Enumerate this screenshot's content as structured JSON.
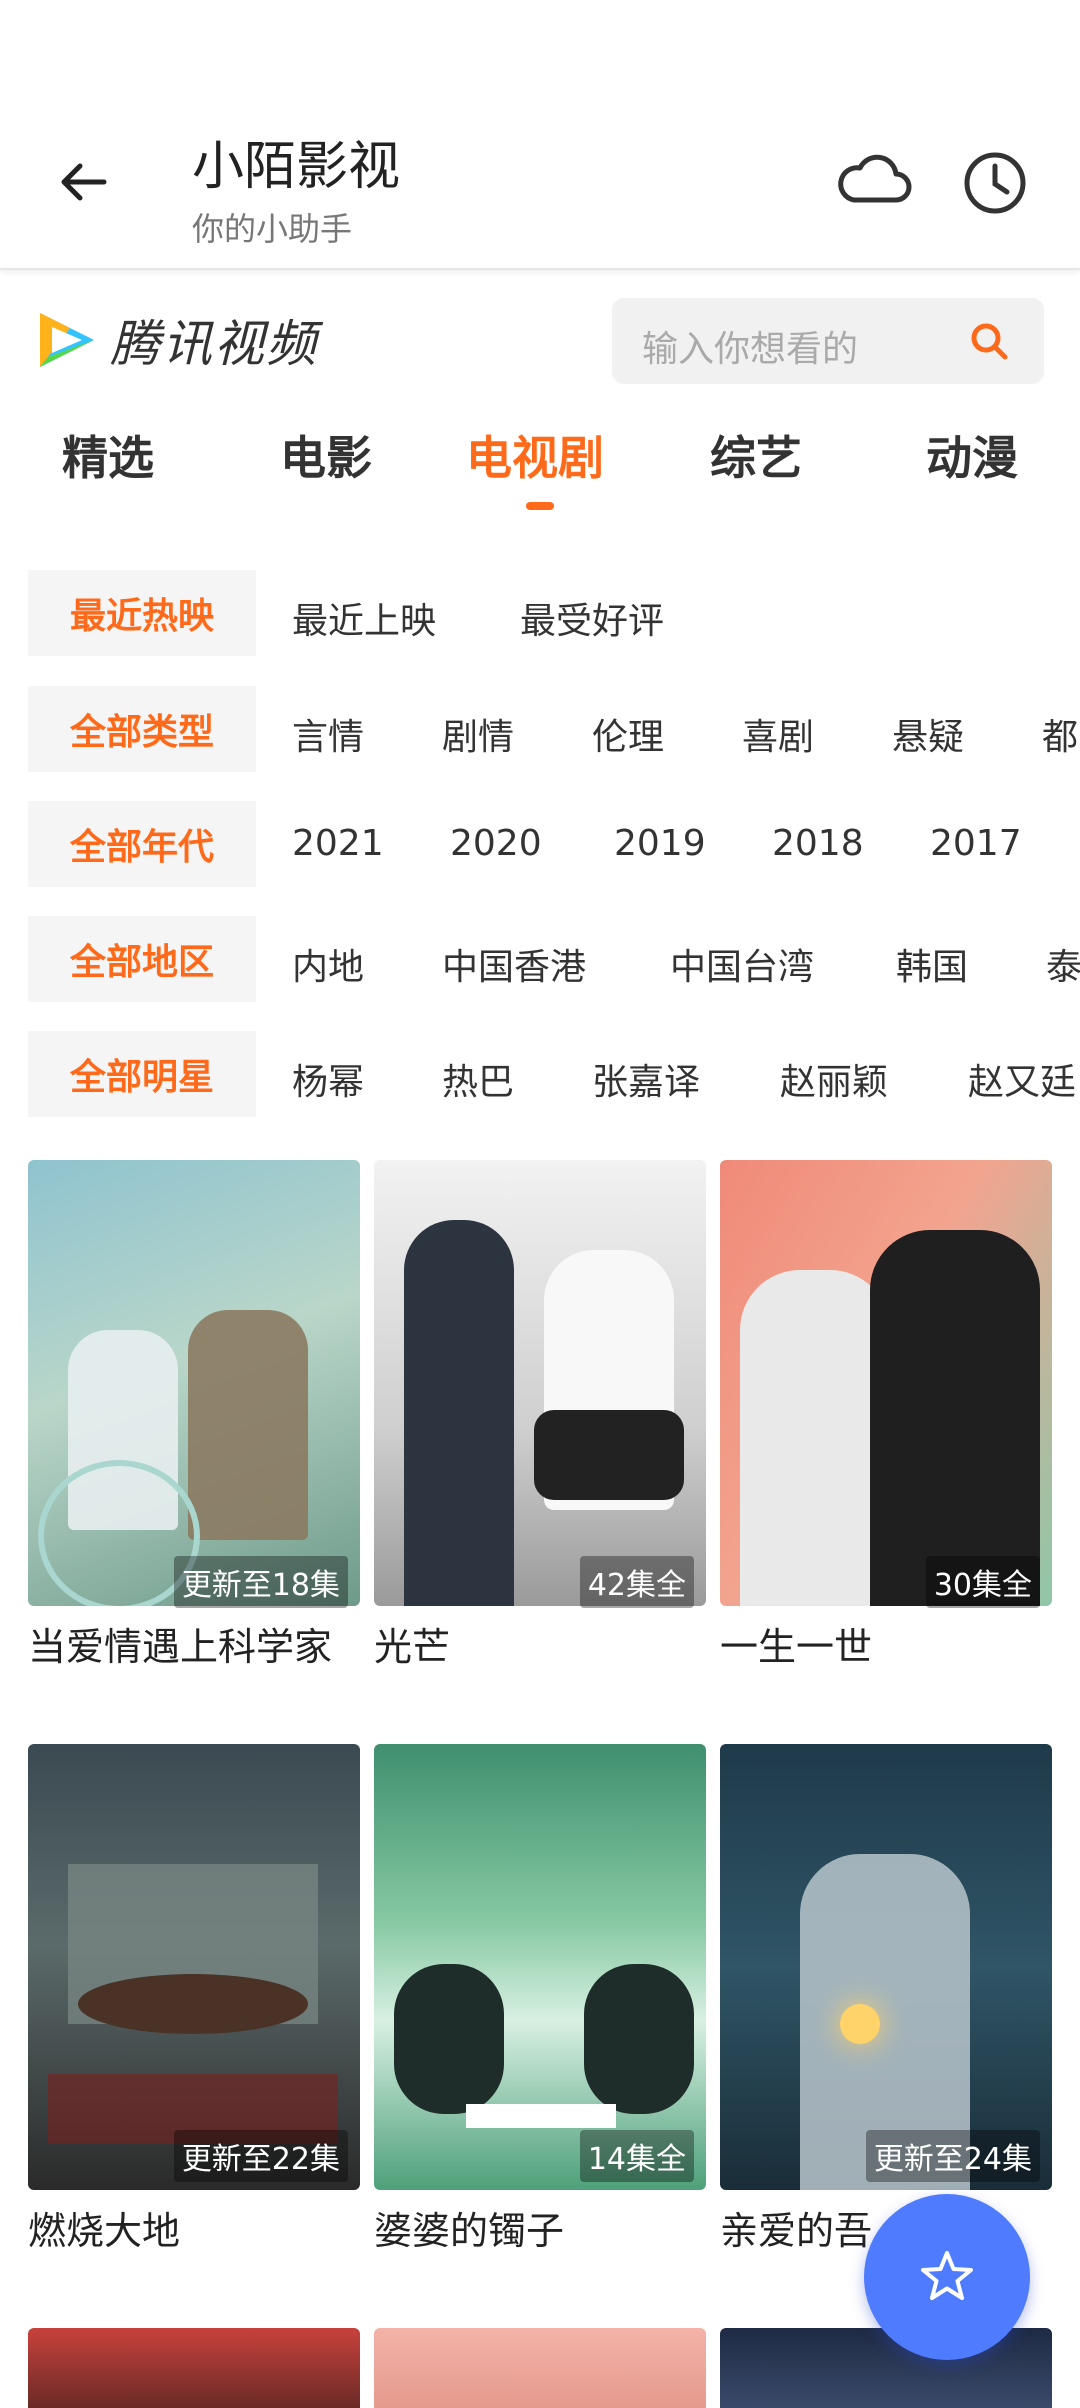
{
  "header": {
    "title": "小陌影视",
    "subtitle": "你的小助手"
  },
  "brand": {
    "name": "腾讯视频"
  },
  "search": {
    "placeholder": "输入你想看的"
  },
  "tabs": [
    {
      "label": "精选",
      "active": false
    },
    {
      "label": "电影",
      "active": false
    },
    {
      "label": "电视剧",
      "active": true
    },
    {
      "label": "综艺",
      "active": false
    },
    {
      "label": "动漫",
      "active": false
    }
  ],
  "filters": [
    {
      "selected": "最近热映",
      "options": [
        "最近上映",
        "最受好评"
      ]
    },
    {
      "selected": "全部类型",
      "options": [
        "言情",
        "剧情",
        "伦理",
        "喜剧",
        "悬疑",
        "都"
      ]
    },
    {
      "selected": "全部年代",
      "options": [
        "2021",
        "2020",
        "2019",
        "2018",
        "2017"
      ]
    },
    {
      "selected": "全部地区",
      "options": [
        "内地",
        "中国香港",
        "中国台湾",
        "韩国",
        "泰"
      ]
    },
    {
      "selected": "全部明星",
      "options": [
        "杨幂",
        "热巴",
        "张嘉译",
        "赵丽颖",
        "赵又廷"
      ]
    }
  ],
  "shows": [
    {
      "title": "当爱情遇上科学家",
      "badge": "更新至18集"
    },
    {
      "title": "光芒",
      "badge": "42集全"
    },
    {
      "title": "一生一世",
      "badge": "30集全"
    },
    {
      "title": "燃烧大地",
      "badge": "更新至22集"
    },
    {
      "title": "婆婆的镯子",
      "badge": "14集全"
    },
    {
      "title": "亲爱的吾",
      "badge": "更新至24集"
    }
  ],
  "colors": {
    "accent": "#ff6a1a",
    "fab": "#4f7cff"
  }
}
